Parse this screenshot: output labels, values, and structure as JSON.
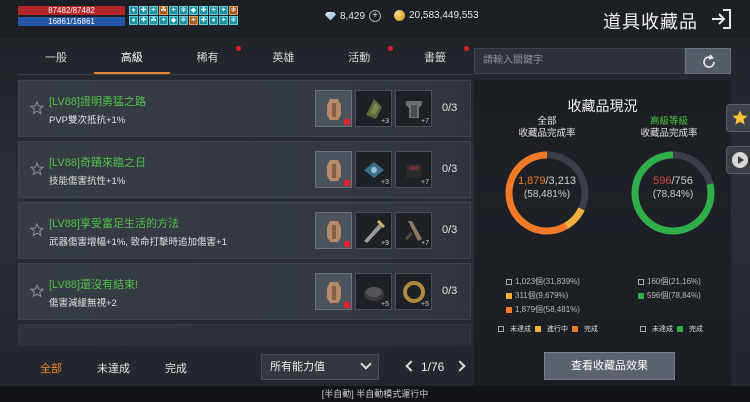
{
  "player": {
    "hp": "87482/87482",
    "mp": "16861/16861"
  },
  "buffs": [
    "♦",
    "✚",
    "☀",
    "☘",
    "✦",
    "❄",
    "◆",
    "✚",
    "☀",
    "✦",
    "❄",
    "♦",
    "✚",
    "☘",
    "✦",
    "◆",
    "❄",
    "☀",
    "✚",
    "♦",
    "✦",
    "❄"
  ],
  "currency": {
    "diamonds": "8,429",
    "gold": "20,583,449,553"
  },
  "header": {
    "title": "道具收藏品"
  },
  "tabs": [
    {
      "label": "一般",
      "dot": false
    },
    {
      "label": "高級",
      "dot": false,
      "active": true
    },
    {
      "label": "稀有",
      "dot": true
    },
    {
      "label": "英雄",
      "dot": false
    },
    {
      "label": "活動",
      "dot": true
    },
    {
      "label": "書籤",
      "dot": true
    }
  ],
  "search": {
    "placeholder": "請輸入關鍵字"
  },
  "items": [
    {
      "title": "[LV88]證明勇猛之路",
      "desc": "PVP雙次抵抗+1%",
      "count": "0/3",
      "slots": [
        {
          "cnt": "",
          "owned": true,
          "red": true
        },
        {
          "cnt": "+3"
        },
        {
          "cnt": "+7"
        }
      ]
    },
    {
      "title": "[LV88]奇蹟來臨之日",
      "desc": "技能傷害抗性+1%",
      "count": "0/3",
      "slots": [
        {
          "cnt": "",
          "owned": true,
          "red": true
        },
        {
          "cnt": "+3"
        },
        {
          "cnt": "+7"
        }
      ]
    },
    {
      "title": "[LV88]享受富足生活的方法",
      "desc": "武器傷害增幅+1%, 致命打擊時追加傷害+1",
      "count": "0/3",
      "slots": [
        {
          "cnt": "",
          "owned": true,
          "red": true
        },
        {
          "cnt": "+9"
        },
        {
          "cnt": "+7"
        }
      ]
    },
    {
      "title": "[LV88]還沒有結束!",
      "desc": "傷害減緩無視+2",
      "count": "0/3",
      "slots": [
        {
          "cnt": "",
          "owned": true,
          "red": true
        },
        {
          "cnt": "+5"
        },
        {
          "cnt": "+5"
        }
      ]
    }
  ],
  "filters": {
    "all": "全部",
    "incomplete": "未達成",
    "complete": "完成"
  },
  "dropdown": {
    "value": "所有能力值"
  },
  "pager": {
    "text": "1/76"
  },
  "status_bar": "[半自動] 半自動模式運行中",
  "panel": {
    "title": "收藏品現況",
    "all": {
      "head1": "全部",
      "head2": "收藏品完成率",
      "done": "1,879",
      "total": "/3,213",
      "pct": "(58,481%)",
      "lines": [
        "1,023個(31,839%)",
        "311個(9,679%)",
        "1,879個(58,481%)"
      ],
      "fractions": [
        0.3184,
        0.0968,
        0.5848
      ]
    },
    "advanced": {
      "head1": "高級等級",
      "head2": "收藏品完成率",
      "done": "596",
      "total": "/756",
      "pct": "(78,84%)",
      "lines": [
        "160個(21,16%)",
        "596個(78,84%)"
      ],
      "fractions": [
        0.2116,
        0.7884
      ]
    },
    "legend": {
      "incomplete": "未達成",
      "in_progress": "進行中",
      "complete": "完成"
    },
    "effect_button": "查看收藏品效果"
  },
  "colors": {
    "accent": "#f08a30",
    "green": "#2fae4a",
    "orange": "#f07a28",
    "red_dot": "#e0222c"
  }
}
